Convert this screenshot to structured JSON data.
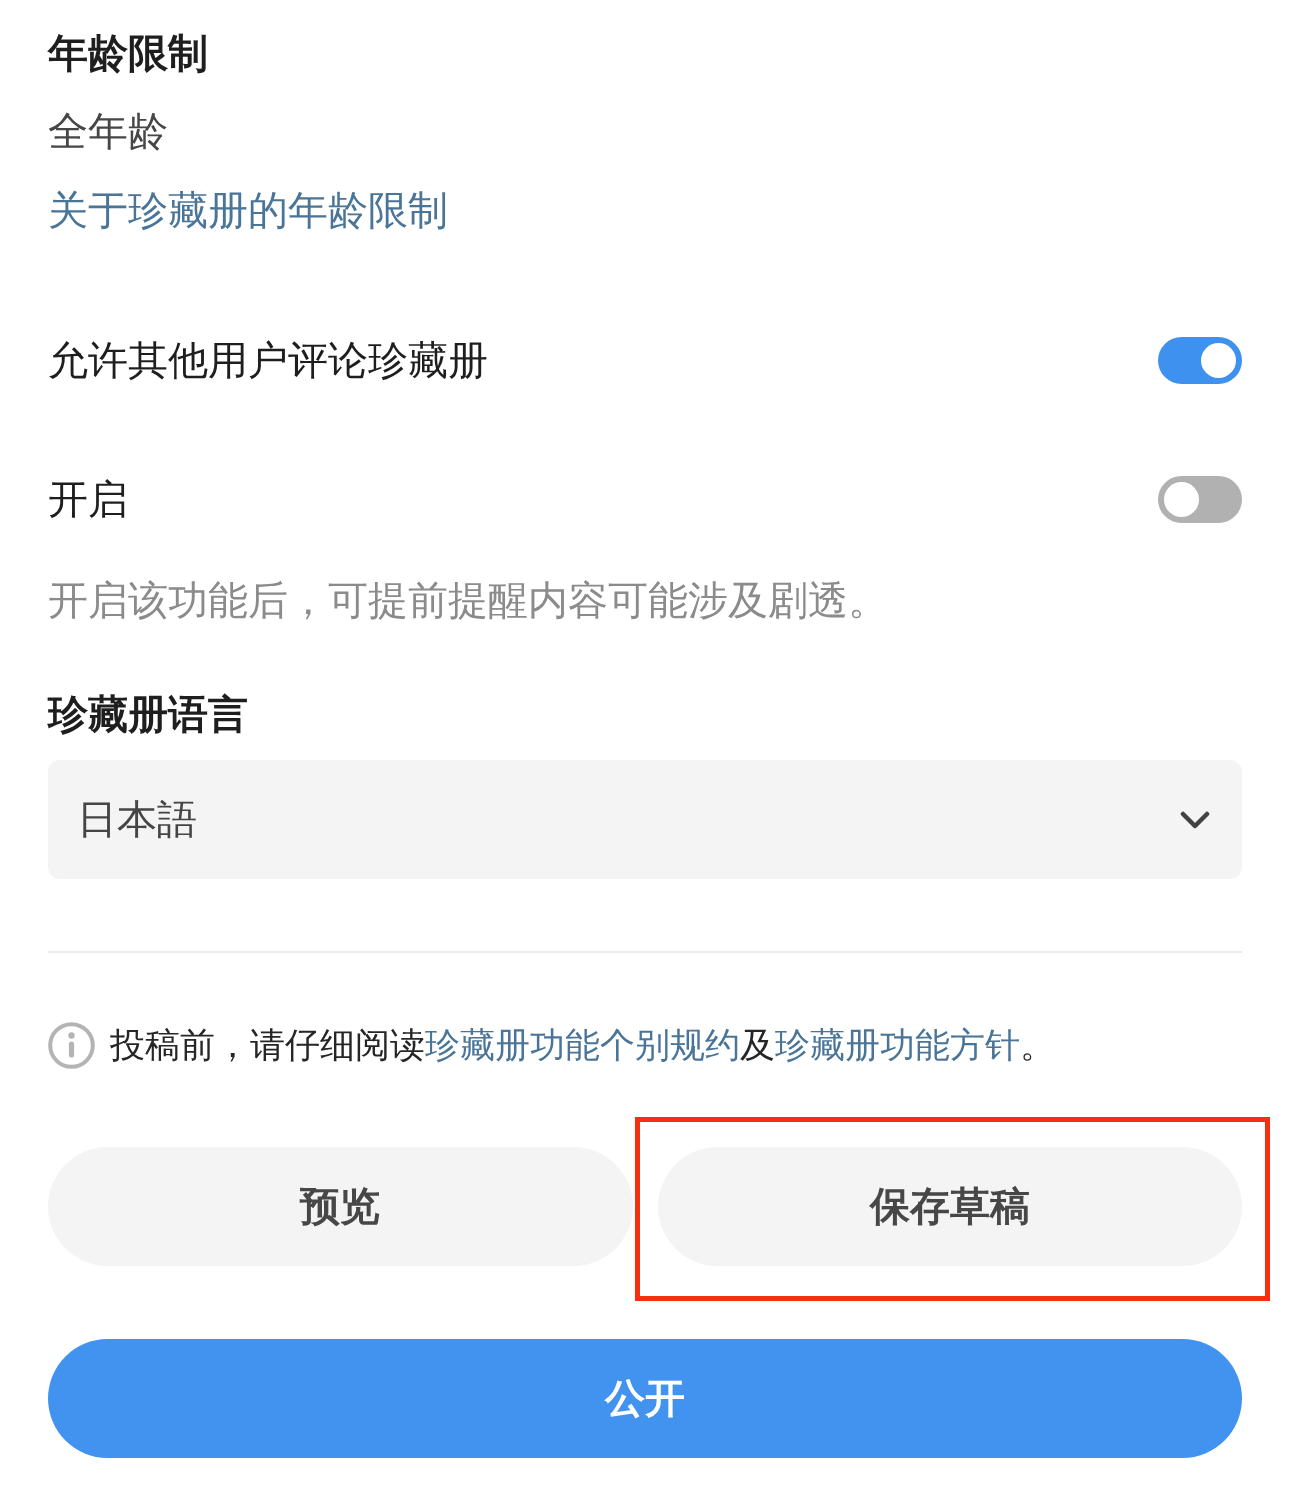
{
  "age_restriction": {
    "heading": "年龄限制",
    "value": "全年龄",
    "link": "关于珍藏册的年龄限制"
  },
  "toggles": [
    {
      "label": "允许其他用户评论珍藏册",
      "on": true
    },
    {
      "label": "开启",
      "on": false
    }
  ],
  "spoiler_note": "开启该功能后，可提前提醒内容可能涉及剧透。",
  "language": {
    "heading": "珍藏册语言",
    "value": "日本語"
  },
  "notice": [
    {
      "kind": "text",
      "text": "投稿前，请仔细阅读"
    },
    {
      "kind": "link",
      "text": "珍藏册功能个别规约"
    },
    {
      "kind": "text",
      "text": "及"
    },
    {
      "kind": "link",
      "text": "珍藏册功能方针"
    },
    {
      "kind": "text",
      "text": "。"
    }
  ],
  "buttons": [
    {
      "label": "预览",
      "kind": "secondary",
      "highlighted": false
    },
    {
      "label": "保存草稿",
      "kind": "secondary",
      "highlighted": true
    },
    {
      "label": "公开",
      "kind": "primary",
      "highlighted": false
    }
  ]
}
